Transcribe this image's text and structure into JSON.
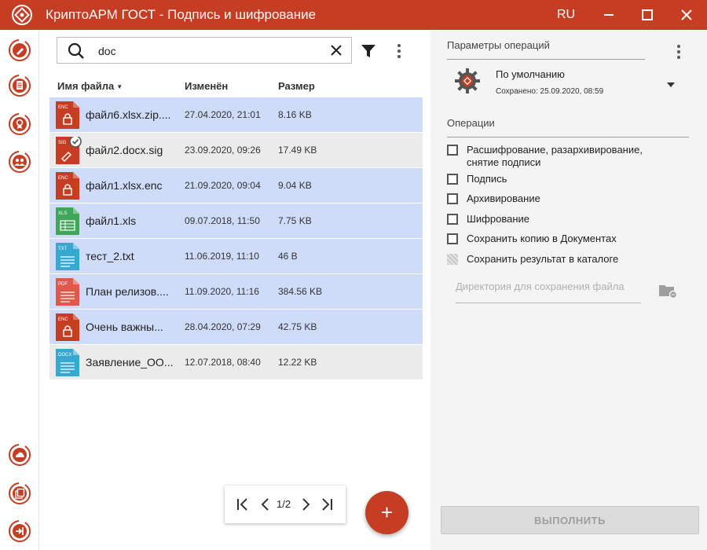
{
  "window": {
    "title": "КриптоАРМ ГОСТ - Подпись и шифрование",
    "language": "RU"
  },
  "colors": {
    "brand": "#c53d22",
    "selected_row": "#cfdcf9",
    "row": "#ebebeb",
    "panel": "#f4f4f4"
  },
  "sidebar": {
    "top_items": [
      {
        "icon": "pen-sign-icon"
      },
      {
        "icon": "document-list-icon"
      },
      {
        "icon": "certificate-icon"
      },
      {
        "icon": "users-icon"
      }
    ],
    "bottom_items": [
      {
        "icon": "cloud-icon"
      },
      {
        "icon": "documents-stack-icon"
      },
      {
        "icon": "exit-icon"
      }
    ]
  },
  "search": {
    "value": "doc",
    "placeholder": ""
  },
  "table": {
    "columns": {
      "name": "Имя файла",
      "modified": "Изменён",
      "size": "Размер"
    },
    "rows": [
      {
        "name": "файл6.xlsx.zip....",
        "modified": "27.04.2020, 21:01",
        "size": "8.16 KB",
        "type": "ENC",
        "selected": true
      },
      {
        "name": "файл2.docx.sig",
        "modified": "23.09.2020, 09:26",
        "size": "17.49 KB",
        "type": "SIG",
        "selected": false
      },
      {
        "name": "файл1.xlsx.enc",
        "modified": "21.09.2020, 09:04",
        "size": "9.04 KB",
        "type": "ENC",
        "selected": true
      },
      {
        "name": "файл1.xls",
        "modified": "09.07.2018, 11:50",
        "size": "7.75 KB",
        "type": "XLS",
        "selected": true
      },
      {
        "name": "тест_2.txt",
        "modified": "11.06.2019, 11:10",
        "size": "46 B",
        "type": "TXT",
        "selected": true
      },
      {
        "name": "План релизов....",
        "modified": "11.09.2020, 11:16",
        "size": "384.56 KB",
        "type": "PDF",
        "selected": true
      },
      {
        "name": "Очень важны...",
        "modified": "28.04.2020, 07:29",
        "size": "42.75 KB",
        "type": "ENC",
        "selected": true
      },
      {
        "name": "Заявление_ОО...",
        "modified": "12.07.2018, 08:40",
        "size": "12.22 KB",
        "type": "DOCX",
        "selected": false
      }
    ]
  },
  "pagination": {
    "label": "1/2"
  },
  "fab": {
    "label": "+"
  },
  "operations_panel": {
    "title": "Параметры операций",
    "profile_name": "По умолчанию",
    "profile_saved": "Сохранено: 25.09.2020, 08:59",
    "ops_title": "Операции",
    "ops": [
      {
        "label": "Расшифрование, разархивирование, снятие подписи",
        "checked": false,
        "disabled": false
      },
      {
        "label": "Подпись",
        "checked": false,
        "disabled": false
      },
      {
        "label": "Архивирование",
        "checked": false,
        "disabled": false
      },
      {
        "label": "Шифрование",
        "checked": false,
        "disabled": false
      },
      {
        "label": "Сохранить копию в Документах",
        "checked": false,
        "disabled": false
      },
      {
        "label": "Сохранить результат в каталоге",
        "checked": false,
        "disabled": true
      }
    ],
    "dir_placeholder": "Директория для сохранения файла",
    "execute_label": "ВЫПОЛНИТЬ"
  }
}
